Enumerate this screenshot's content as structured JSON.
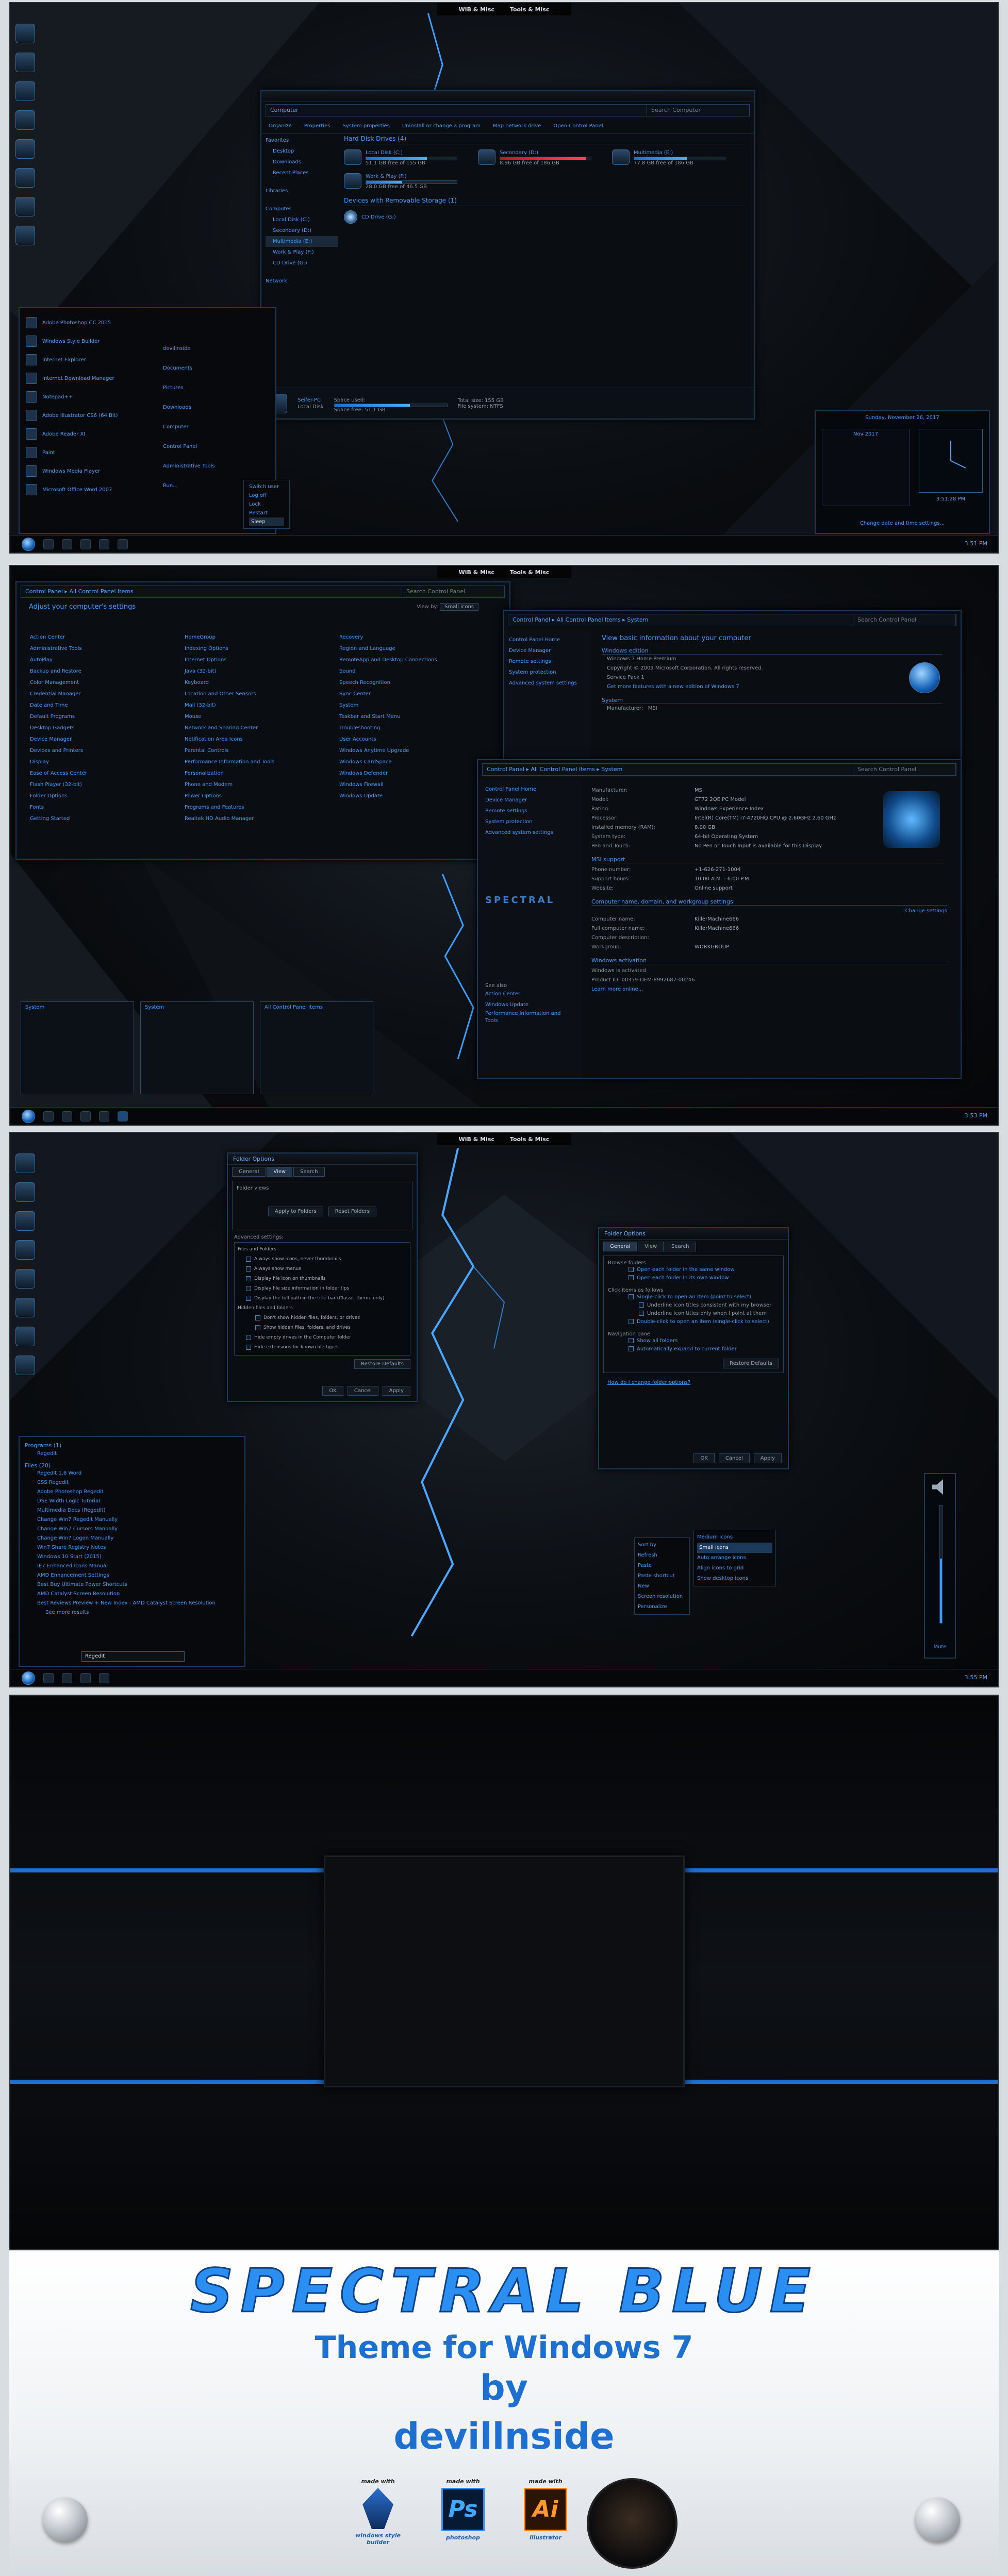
{
  "topbar": {
    "left": "WiB & Misc",
    "right": "Tools & Misc"
  },
  "shot1": {
    "explorer": {
      "address": "Computer",
      "search": "Search Computer",
      "toolbar": [
        "Organize",
        "Properties",
        "System properties",
        "Uninstall or change a program",
        "Map network drive",
        "Open Control Panel"
      ],
      "nav": [
        "Favorites",
        "Desktop",
        "Downloads",
        "Recent Places",
        "Libraries",
        "Computer",
        "Local Disk (C:)",
        "Secondary (D:)",
        "Multimedia (E:)",
        "Work & Play (F:)",
        "CD Drive (G:)",
        "Network"
      ],
      "section_hdd": "Hard Disk Drives (4)",
      "drives": [
        {
          "name": "Local Disk (C:)",
          "free": "51.1 GB free of 155 GB",
          "fill": 0.67,
          "red": false
        },
        {
          "name": "Secondary (D:)",
          "free": "8.96 GB free of 186 GB",
          "fill": 0.95,
          "red": true
        },
        {
          "name": "Multimedia (E:)",
          "free": "77.8 GB free of 186 GB",
          "fill": 0.58,
          "red": false
        },
        {
          "name": "Work & Play (F:)",
          "free": "28.0 GB free of 46.5 GB",
          "fill": 0.4,
          "red": false
        }
      ],
      "section_removable": "Devices with Removable Storage (1)",
      "cd": "CD Drive (G:)",
      "footer": {
        "name": "Seifer-PC",
        "label": "Local Disk",
        "used_label": "Space used:",
        "total": "Total size: 155 GB",
        "free": "Space free: 51.1 GB",
        "fs": "File system: NTFS",
        "fill": 0.67
      }
    },
    "startmenu": {
      "programs": [
        "Adobe Photoshop CC 2015",
        "Windows Style Builder",
        "Internet Explorer",
        "Internet Download Manager",
        "Notepad++",
        "Adobe Illustrator CS6 (64 Bit)",
        "Adobe Reader XI",
        "Paint",
        "Windows Media Player",
        "Microsoft Office Word 2007"
      ],
      "right": [
        "devillnside",
        "Documents",
        "Pictures",
        "Downloads",
        "Computer",
        "Control Panel",
        "Administrative Tools",
        "Run..."
      ],
      "power": [
        "Switch user",
        "Log off",
        "Lock",
        "Restart",
        "Sleep"
      ]
    },
    "clock": {
      "date": "Sunday, November 26, 2017",
      "months": "Nov 2017",
      "time": "3:51:28 PM",
      "link": "Change date and time settings..."
    },
    "time": "3:51 PM"
  },
  "shot2": {
    "cp": {
      "address": "Control Panel  ▸  All Control Panel Items",
      "search": "Search Control Panel",
      "heading": "Adjust your computer's settings",
      "viewby": "View by:",
      "viewval": "Small icons",
      "items": [
        "Action Center",
        "Administrative Tools",
        "AutoPlay",
        "Backup and Restore",
        "Color Management",
        "Credential Manager",
        "Date and Time",
        "Default Programs",
        "Desktop Gadgets",
        "Device Manager",
        "Devices and Printers",
        "Display",
        "Ease of Access Center",
        "Flash Player (32-bit)",
        "Folder Options",
        "Fonts",
        "Getting Started",
        "HomeGroup",
        "Indexing Options",
        "Internet Options",
        "Java (32-bit)",
        "Keyboard",
        "Location and Other Sensors",
        "Mail (32-bit)",
        "Mouse",
        "Network and Sharing Center",
        "Notification Area Icons",
        "Parental Controls",
        "Performance Information and Tools",
        "Personalization",
        "Phone and Modem",
        "Power Options",
        "Programs and Features",
        "Realtek HD Audio Manager",
        "Recovery",
        "Region and Language",
        "RemoteApp and Desktop Connections",
        "Sound",
        "Speech Recognition",
        "Sync Center",
        "System",
        "Taskbar and Start Menu",
        "Troubleshooting",
        "User Accounts",
        "Windows Anytime Upgrade",
        "Windows CardSpace",
        "Windows Defender",
        "Windows Firewall",
        "Windows Update"
      ]
    },
    "sys1": {
      "address": "Control Panel  ▸  All Control Panel Items  ▸  System",
      "search": "Search Control Panel",
      "side": [
        "Control Panel Home",
        "Device Manager",
        "Remote settings",
        "System protection",
        "Advanced system settings"
      ],
      "title": "View basic information about your computer",
      "edition": "Windows edition",
      "rows": [
        "Windows 7 Home Premium",
        "Copyright © 2009 Microsoft Corporation.  All rights reserved.",
        "Service Pack 1",
        "Get more features with a new edition of Windows 7"
      ],
      "system": "System",
      "manu": "Manufacturer:",
      "manu_val": "MSI"
    },
    "sys2": {
      "address": "Control Panel  ▸  All Control Panel Items  ▸  System",
      "search": "Search Control Panel",
      "side": [
        "Control Panel Home",
        "Device Manager",
        "Remote settings",
        "System protection",
        "Advanced system settings"
      ],
      "seealso": [
        "See also",
        "Action Center",
        "Windows Update",
        "Performance Information and Tools"
      ],
      "brand": "SPECTRAL",
      "details": [
        [
          "Manufacturer:",
          "MSI"
        ],
        [
          "Model:",
          "GT72 2QE PC Model"
        ],
        [
          "Rating:",
          "Windows Experience Index"
        ],
        [
          "Processor:",
          "Intel(R) Core(TM) i7-4720HQ CPU @ 2.60GHz  2.60 GHz"
        ],
        [
          "Installed memory (RAM):",
          "8.00 GB"
        ],
        [
          "System type:",
          "64-bit Operating System"
        ],
        [
          "Pen and Touch:",
          "No Pen or Touch Input is available for this Display"
        ]
      ],
      "support_hdr": "MSI support",
      "support": [
        [
          "Phone number:",
          "+1-626-271-1004"
        ],
        [
          "Support hours:",
          "10:00 A.M. - 6:00 P.M."
        ],
        [
          "Website:",
          "Online support"
        ]
      ],
      "name_hdr": "Computer name, domain, and workgroup settings",
      "change": "Change settings",
      "names": [
        [
          "Computer name:",
          "KillerMachine666"
        ],
        [
          "Full computer name:",
          "KillerMachine666"
        ],
        [
          "Computer description:",
          ""
        ],
        [
          "Workgroup:",
          "WORKGROUP"
        ]
      ],
      "act_hdr": "Windows activation",
      "act": "Windows is activated",
      "pid": "Product ID: 00359-OEM-8992687-00246",
      "learn": "Learn more online..."
    },
    "thumbs": [
      "System",
      "System",
      "All Control Panel Items"
    ],
    "time": "3:53 PM"
  },
  "shot3": {
    "fo1": {
      "title": "Folder Options",
      "tabs": [
        "General",
        "View",
        "Search"
      ],
      "group": "Folder views",
      "btn1": "Apply to Folders",
      "btn2": "Reset Folders",
      "adv": "Advanced settings:",
      "list": [
        "Files and Folders",
        "Always show icons, never thumbnails",
        "Always show menus",
        "Display file icon on thumbnails",
        "Display file size information in folder tips",
        "Display the full path in the title bar (Classic theme only)",
        "Hidden files and folders",
        "Don't show hidden files, folders, or drives",
        "Show hidden files, folders, and drives",
        "Hide empty drives in the Computer folder",
        "Hide extensions for known file types"
      ],
      "restore": "Restore Defaults",
      "ok": "OK",
      "cancel": "Cancel",
      "apply": "Apply"
    },
    "fo2": {
      "title": "Folder Options",
      "tabs": [
        "General",
        "View",
        "Search"
      ],
      "browse": "Browse folders",
      "b1": "Open each folder in the same window",
      "b2": "Open each folder in its own window",
      "click": "Click items as follows",
      "c1": "Single-click to open an item (point to select)",
      "c2": "Underline icon titles consistent with my browser",
      "c3": "Underline icon titles only when I point at them",
      "c4": "Double-click to open an item (single-click to select)",
      "nav": "Navigation pane",
      "n1": "Show all folders",
      "n2": "Automatically expand to current folder",
      "restore": "Restore Defaults",
      "how": "How do I change folder options?",
      "ok": "OK",
      "cancel": "Cancel",
      "apply": "Apply"
    },
    "search": {
      "programs_hdr": "Programs (1)",
      "program": "Regedit",
      "files_hdr": "Files (20)",
      "files": [
        "Regedit 1.6 Word",
        "CSS Regedit",
        "Adobe Photoshop Regedit",
        "DSE Width Logic Tutorial",
        "Multimedia Docs (Regedit)",
        "Change Win7 Regedit Manually",
        "Change Win7 Cursors Manually",
        "Change Win7 Logon Manually",
        "Win7 Share Registry Notes",
        "Windows 10 Start (2015)",
        "IE7 Enhanced Icons Manual",
        "AMD Enhancement Settings",
        "Best Buy Ultimate Power Shortcuts",
        "AMD Catalyst Screen Resolution",
        "Best Reviews Preview + New Index - AMD Catalyst Screen Resolution"
      ],
      "see_more": "See more results",
      "query": "Regedit"
    },
    "ctx": {
      "left": [
        "Sort by",
        "Refresh",
        "Paste",
        "Paste shortcut",
        "New",
        "Screen resolution",
        "Personalize"
      ],
      "right": [
        "Medium icons",
        "Small icons",
        "Auto arrange icons",
        "Align icons to grid",
        "Show desktop icons"
      ]
    },
    "volume": {
      "label": "Mute",
      "level": 0.55
    },
    "time": "3:55 PM"
  },
  "promo": {
    "title": "SPECTRAL BLUE",
    "subtitle": "Theme for Windows 7",
    "by": "by",
    "author": "devillnside",
    "made": [
      {
        "line1": "made with",
        "line2": "windows style builder"
      },
      {
        "line1": "made with",
        "line2": "photoshop"
      },
      {
        "line1": "made with",
        "line2": "illustrator"
      }
    ],
    "ps": "Ps",
    "ai": "Ai"
  }
}
